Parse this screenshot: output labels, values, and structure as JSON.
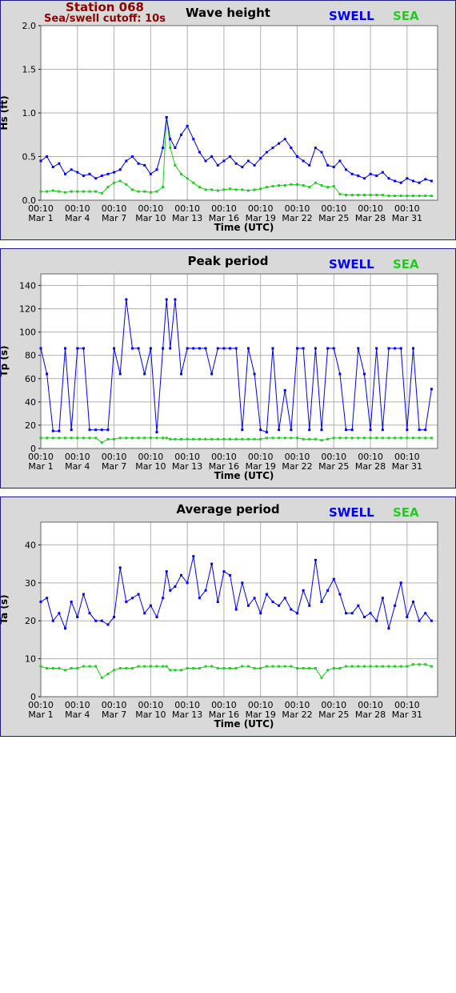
{
  "station": {
    "name": "Station 068",
    "cutoff": "Sea/swell cutoff: 10s"
  },
  "legend": {
    "swell": "SWELL",
    "sea": "SEA"
  },
  "colors": {
    "swell": "#0000ee",
    "sea": "#22cc22",
    "panel_bg": "#d9d9d9",
    "plot_bg": "#ffffff",
    "grid": "#b0b0b0"
  },
  "x_axis": {
    "label": "Time (UTC)",
    "range_days": [
      0,
      32.5
    ],
    "ticks": [
      {
        "day": 0,
        "time": "00:10",
        "date": "Mar 1"
      },
      {
        "day": 3,
        "time": "00:10",
        "date": "Mar 4"
      },
      {
        "day": 6,
        "time": "00:10",
        "date": "Mar 7"
      },
      {
        "day": 9,
        "time": "00:10",
        "date": "Mar 10"
      },
      {
        "day": 12,
        "time": "00:10",
        "date": "Mar 13"
      },
      {
        "day": 15,
        "time": "00:10",
        "date": "Mar 16"
      },
      {
        "day": 18,
        "time": "00:10",
        "date": "Mar 19"
      },
      {
        "day": 21,
        "time": "00:10",
        "date": "Mar 22"
      },
      {
        "day": 24,
        "time": "00:10",
        "date": "Mar 25"
      },
      {
        "day": 27,
        "time": "00:10",
        "date": "Mar 28"
      },
      {
        "day": 30,
        "time": "00:10",
        "date": "Mar 31"
      }
    ]
  },
  "chart_data": [
    {
      "type": "line",
      "title": "Wave height",
      "ylabel": "Hs (ft)",
      "ylim": [
        0,
        2.0
      ],
      "yticks": [
        "0.0",
        "0.5",
        "1.0",
        "1.5",
        "2.0"
      ],
      "ytick_values": [
        0,
        0.5,
        1.0,
        1.5,
        2.0
      ],
      "series": [
        {
          "name": "SWELL",
          "color": "#0000ee",
          "x": [
            0,
            0.5,
            1,
            1.5,
            2,
            2.5,
            3,
            3.5,
            4,
            4.5,
            5,
            5.5,
            6,
            6.5,
            7,
            7.5,
            8,
            8.5,
            9,
            9.5,
            10,
            10.3,
            10.6,
            11,
            11.5,
            12,
            12.5,
            13,
            13.5,
            14,
            14.5,
            15,
            15.5,
            16,
            16.5,
            17,
            17.5,
            18,
            18.5,
            19,
            19.5,
            20,
            20.5,
            21,
            21.5,
            22,
            22.5,
            23,
            23.5,
            24,
            24.5,
            25,
            25.5,
            26,
            26.5,
            27,
            27.5,
            28,
            28.5,
            29,
            29.5,
            30,
            30.5,
            31,
            31.5,
            32
          ],
          "y": [
            0.45,
            0.5,
            0.38,
            0.42,
            0.3,
            0.35,
            0.32,
            0.28,
            0.3,
            0.25,
            0.28,
            0.3,
            0.32,
            0.35,
            0.45,
            0.5,
            0.42,
            0.4,
            0.3,
            0.35,
            0.6,
            0.95,
            0.7,
            0.6,
            0.75,
            0.85,
            0.7,
            0.55,
            0.45,
            0.5,
            0.4,
            0.45,
            0.5,
            0.42,
            0.38,
            0.45,
            0.4,
            0.48,
            0.55,
            0.6,
            0.65,
            0.7,
            0.6,
            0.5,
            0.45,
            0.4,
            0.6,
            0.55,
            0.4,
            0.38,
            0.45,
            0.35,
            0.3,
            0.28,
            0.25,
            0.3,
            0.28,
            0.32,
            0.25,
            0.22,
            0.2,
            0.25,
            0.22,
            0.2,
            0.24,
            0.22
          ]
        },
        {
          "name": "SEA",
          "color": "#22cc22",
          "x": [
            0,
            0.5,
            1,
            1.5,
            2,
            2.5,
            3,
            3.5,
            4,
            4.5,
            5,
            5.5,
            6,
            6.5,
            7,
            7.5,
            8,
            8.5,
            9,
            9.5,
            10,
            10.3,
            10.6,
            11,
            11.5,
            12,
            12.5,
            13,
            13.5,
            14,
            14.5,
            15,
            15.5,
            16,
            16.5,
            17,
            17.5,
            18,
            18.5,
            19,
            19.5,
            20,
            20.5,
            21,
            21.5,
            22,
            22.5,
            23,
            23.5,
            24,
            24.5,
            25,
            25.5,
            26,
            26.5,
            27,
            27.5,
            28,
            28.5,
            29,
            29.5,
            30,
            30.5,
            31,
            31.5,
            32
          ],
          "y": [
            0.1,
            0.1,
            0.11,
            0.1,
            0.09,
            0.1,
            0.1,
            0.1,
            0.1,
            0.1,
            0.08,
            0.15,
            0.2,
            0.22,
            0.18,
            0.12,
            0.1,
            0.1,
            0.09,
            0.1,
            0.15,
            0.95,
            0.6,
            0.4,
            0.3,
            0.25,
            0.2,
            0.15,
            0.12,
            0.12,
            0.11,
            0.12,
            0.13,
            0.12,
            0.12,
            0.11,
            0.12,
            0.13,
            0.15,
            0.16,
            0.17,
            0.17,
            0.18,
            0.18,
            0.17,
            0.15,
            0.2,
            0.17,
            0.15,
            0.16,
            0.07,
            0.06,
            0.06,
            0.06,
            0.06,
            0.06,
            0.06,
            0.06,
            0.05,
            0.05,
            0.05,
            0.05,
            0.05,
            0.05,
            0.05,
            0.05
          ]
        }
      ]
    },
    {
      "type": "line",
      "title": "Peak period",
      "ylabel": "Tp (s)",
      "ylim": [
        0,
        150
      ],
      "yticks": [
        "0",
        "20",
        "40",
        "60",
        "80",
        "100",
        "120",
        "140"
      ],
      "ytick_values": [
        0,
        20,
        40,
        60,
        80,
        100,
        120,
        140
      ],
      "series": [
        {
          "name": "SWELL",
          "color": "#0000ee",
          "x": [
            0,
            0.5,
            1,
            1.5,
            2,
            2.5,
            3,
            3.5,
            4,
            4.5,
            5,
            5.5,
            6,
            6.5,
            7,
            7.5,
            8,
            8.5,
            9,
            9.5,
            10,
            10.3,
            10.6,
            11,
            11.5,
            12,
            12.5,
            13,
            13.5,
            14,
            14.5,
            15,
            15.5,
            16,
            16.5,
            17,
            17.5,
            18,
            18.5,
            19,
            19.5,
            20,
            20.5,
            21,
            21.5,
            22,
            22.5,
            23,
            23.5,
            24,
            24.5,
            25,
            25.5,
            26,
            26.5,
            27,
            27.5,
            28,
            28.5,
            29,
            29.5,
            30,
            30.5,
            31,
            31.5,
            32
          ],
          "y": [
            86,
            64,
            15,
            15,
            86,
            16,
            86,
            86,
            16,
            16,
            16,
            16,
            86,
            64,
            128,
            86,
            86,
            64,
            86,
            14,
            86,
            128,
            86,
            128,
            64,
            86,
            86,
            86,
            86,
            64,
            86,
            86,
            86,
            86,
            16,
            86,
            64,
            16,
            14,
            86,
            16,
            50,
            16,
            86,
            86,
            16,
            86,
            16,
            86,
            86,
            64,
            16,
            16,
            86,
            64,
            16,
            86,
            16,
            86,
            86,
            86,
            16,
            86,
            16,
            16,
            51
          ]
        },
        {
          "name": "SEA",
          "color": "#22cc22",
          "x": [
            0,
            0.5,
            1,
            1.5,
            2,
            2.5,
            3,
            3.5,
            4,
            4.5,
            5,
            5.5,
            6,
            6.5,
            7,
            7.5,
            8,
            8.5,
            9,
            9.5,
            10,
            10.3,
            10.6,
            11,
            11.5,
            12,
            12.5,
            13,
            13.5,
            14,
            14.5,
            15,
            15.5,
            16,
            16.5,
            17,
            17.5,
            18,
            18.5,
            19,
            19.5,
            20,
            20.5,
            21,
            21.5,
            22,
            22.5,
            23,
            23.5,
            24,
            24.5,
            25,
            25.5,
            26,
            26.5,
            27,
            27.5,
            28,
            28.5,
            29,
            29.5,
            30,
            30.5,
            31,
            31.5,
            32
          ],
          "y": [
            9,
            9,
            9,
            9,
            9,
            9,
            9,
            9,
            9,
            9,
            5,
            8,
            8,
            9,
            9,
            9,
            9,
            9,
            9,
            9,
            9,
            9,
            8,
            8,
            8,
            8,
            8,
            8,
            8,
            8,
            8,
            8,
            8,
            8,
            8,
            8,
            8,
            8,
            9,
            9,
            9,
            9,
            9,
            9,
            8,
            8,
            8,
            7,
            8,
            9,
            9,
            9,
            9,
            9,
            9,
            9,
            9,
            9,
            9,
            9,
            9,
            9,
            9,
            9,
            9,
            9
          ]
        }
      ]
    },
    {
      "type": "line",
      "title": "Average period",
      "ylabel": "Ta (s)",
      "ylim": [
        0,
        46
      ],
      "yticks": [
        "0",
        "10",
        "20",
        "30",
        "40"
      ],
      "ytick_values": [
        0,
        10,
        20,
        30,
        40
      ],
      "series": [
        {
          "name": "SWELL",
          "color": "#0000ee",
          "x": [
            0,
            0.5,
            1,
            1.5,
            2,
            2.5,
            3,
            3.5,
            4,
            4.5,
            5,
            5.5,
            6,
            6.5,
            7,
            7.5,
            8,
            8.5,
            9,
            9.5,
            10,
            10.3,
            10.6,
            11,
            11.5,
            12,
            12.5,
            13,
            13.5,
            14,
            14.5,
            15,
            15.5,
            16,
            16.5,
            17,
            17.5,
            18,
            18.5,
            19,
            19.5,
            20,
            20.5,
            21,
            21.5,
            22,
            22.5,
            23,
            23.5,
            24,
            24.5,
            25,
            25.5,
            26,
            26.5,
            27,
            27.5,
            28,
            28.5,
            29,
            29.5,
            30,
            30.5,
            31,
            31.5,
            32
          ],
          "y": [
            25,
            26,
            20,
            22,
            18,
            25,
            21,
            27,
            22,
            20,
            20,
            19,
            21,
            34,
            25,
            26,
            27,
            22,
            24,
            21,
            26,
            33,
            28,
            29,
            32,
            30,
            37,
            26,
            28,
            35,
            25,
            33,
            32,
            23,
            30,
            24,
            26,
            22,
            27,
            25,
            24,
            26,
            23,
            22,
            28,
            24,
            36,
            25,
            28,
            31,
            27,
            22,
            22,
            24,
            21,
            22,
            20,
            26,
            18,
            24,
            30,
            21,
            25,
            20,
            22,
            20
          ]
        },
        {
          "name": "SEA",
          "color": "#22cc22",
          "x": [
            0,
            0.5,
            1,
            1.5,
            2,
            2.5,
            3,
            3.5,
            4,
            4.5,
            5,
            5.5,
            6,
            6.5,
            7,
            7.5,
            8,
            8.5,
            9,
            9.5,
            10,
            10.3,
            10.6,
            11,
            11.5,
            12,
            12.5,
            13,
            13.5,
            14,
            14.5,
            15,
            15.5,
            16,
            16.5,
            17,
            17.5,
            18,
            18.5,
            19,
            19.5,
            20,
            20.5,
            21,
            21.5,
            22,
            22.5,
            23,
            23.5,
            24,
            24.5,
            25,
            25.5,
            26,
            26.5,
            27,
            27.5,
            28,
            28.5,
            29,
            29.5,
            30,
            30.5,
            31,
            31.5,
            32
          ],
          "y": [
            8,
            7.5,
            7.5,
            7.5,
            7,
            7.5,
            7.5,
            8,
            8,
            8,
            5,
            6,
            7,
            7.5,
            7.5,
            7.5,
            8,
            8,
            8,
            8,
            8,
            8,
            7,
            7,
            7,
            7.5,
            7.5,
            7.5,
            8,
            8,
            7.5,
            7.5,
            7.5,
            7.5,
            8,
            8,
            7.5,
            7.5,
            8,
            8,
            8,
            8,
            8,
            7.5,
            7.5,
            7.5,
            7.5,
            5,
            7,
            7.5,
            7.5,
            8,
            8,
            8,
            8,
            8,
            8,
            8,
            8,
            8,
            8,
            8,
            8.5,
            8.5,
            8.5,
            8
          ]
        }
      ]
    }
  ]
}
